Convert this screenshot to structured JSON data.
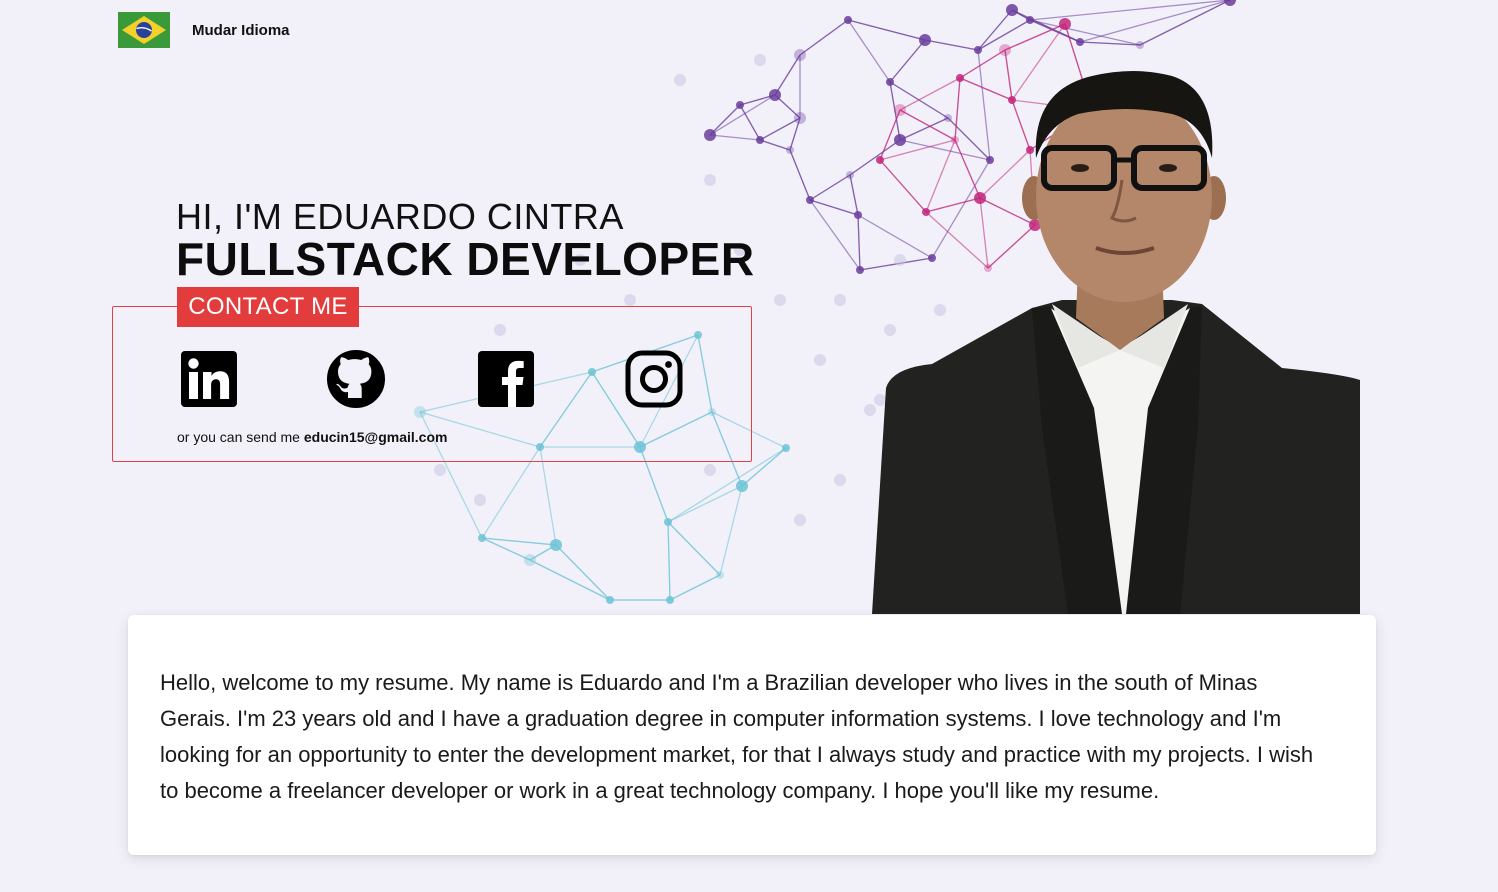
{
  "header": {
    "language_label": "Mudar Idioma",
    "flag_icon": "brazil-flag-icon"
  },
  "hero": {
    "greeting": "HI, I'M EDUARDO CINTRA",
    "role": "FULLSTACK DEVELOPER"
  },
  "contact": {
    "tab_label": "CONTACT ME",
    "socials": [
      {
        "name": "linkedin",
        "icon": "linkedin-icon"
      },
      {
        "name": "github",
        "icon": "github-icon"
      },
      {
        "name": "facebook",
        "icon": "facebook-icon"
      },
      {
        "name": "instagram",
        "icon": "instagram-icon"
      }
    ],
    "email_prefix": "or you can send me ",
    "email": "educin15@gmail.com"
  },
  "about": {
    "text": "Hello, welcome to my resume. My name is Eduardo and I'm a Brazilian developer who lives in the south of Minas Gerais. I'm 23 years old and I have a graduation degree in computer information systems. I love technology and I'm looking for an opportunity to enter the development market, for that I always study and practice with my projects. I wish to become a freelancer developer or work in a great technology company. I hope you'll like my resume."
  },
  "colors": {
    "background": "#f2f1fa",
    "accent_red": "#e23c3c",
    "network_purple": "#6a3d9a",
    "network_pink": "#c2247a",
    "network_cyan": "#6cc3d5"
  }
}
